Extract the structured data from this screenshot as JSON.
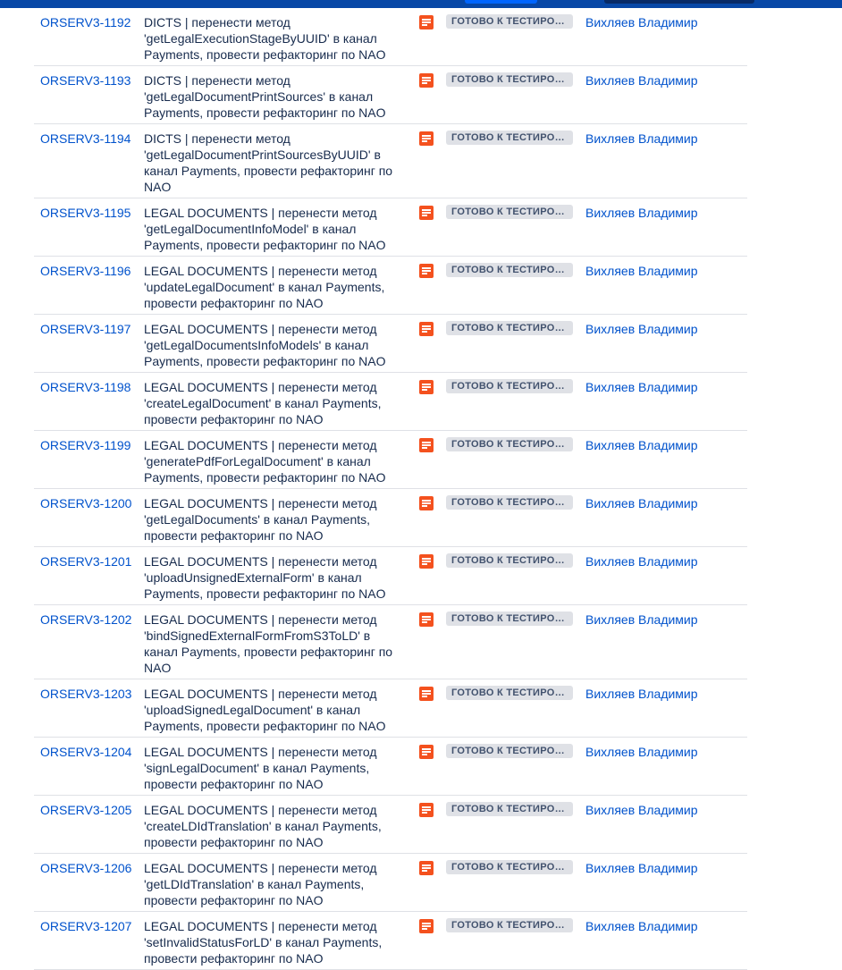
{
  "issues": [
    {
      "key": "ORSERV3-1192",
      "summary": "DICTS | перенести метод 'getLegalExecutionStageByUUID' в канал Payments, провести рефакторинг по NAO",
      "status": "ГОТОВО К ТЕСТИРОВАНИЮ",
      "assignee": "Вихляев Владимир",
      "type_icon": "task-icon"
    },
    {
      "key": "ORSERV3-1193",
      "summary": "DICTS | перенести метод 'getLegalDocumentPrintSources' в канал Payments, провести рефакторинг по NAO",
      "status": "ГОТОВО К ТЕСТИРОВАНИЮ",
      "assignee": "Вихляев Владимир",
      "type_icon": "task-icon"
    },
    {
      "key": "ORSERV3-1194",
      "summary": "DICTS | перенести метод 'getLegalDocumentPrintSourcesByUUID' в канал Payments, провести рефакторинг по NAO",
      "status": "ГОТОВО К ТЕСТИРОВАНИЮ",
      "assignee": "Вихляев Владимир",
      "type_icon": "task-icon"
    },
    {
      "key": "ORSERV3-1195",
      "summary": "LEGAL DOCUMENTS | перенести метод 'getLegalDocumentInfoModel' в канал Payments, провести рефакторинг по NAO",
      "status": "ГОТОВО К ТЕСТИРОВАНИЮ",
      "assignee": "Вихляев Владимир",
      "type_icon": "task-icon"
    },
    {
      "key": "ORSERV3-1196",
      "summary": "LEGAL DOCUMENTS | перенести метод 'updateLegalDocument' в канал Payments, провести рефакторинг по NAO",
      "status": "ГОТОВО К ТЕСТИРОВАНИЮ",
      "assignee": "Вихляев Владимир",
      "type_icon": "task-icon"
    },
    {
      "key": "ORSERV3-1197",
      "summary": "LEGAL DOCUMENTS | перенести метод 'getLegalDocumentsInfoModels' в канал Payments, провести рефакторинг по NAO",
      "status": "ГОТОВО К ТЕСТИРОВАНИЮ",
      "assignee": "Вихляев Владимир",
      "type_icon": "task-icon"
    },
    {
      "key": "ORSERV3-1198",
      "summary": "LEGAL DOCUMENTS | перенести метод 'createLegalDocument' в канал Payments, провести рефакторинг по NAO",
      "status": "ГОТОВО К ТЕСТИРОВАНИЮ",
      "assignee": "Вихляев Владимир",
      "type_icon": "task-icon"
    },
    {
      "key": "ORSERV3-1199",
      "summary": "LEGAL DOCUMENTS | перенести метод 'generatePdfForLegalDocument' в канал Payments, провести рефакторинг по NAO",
      "status": "ГОТОВО К ТЕСТИРОВАНИЮ",
      "assignee": "Вихляев Владимир",
      "type_icon": "task-icon"
    },
    {
      "key": "ORSERV3-1200",
      "summary": "LEGAL DOCUMENTS | перенести метод 'getLegalDocuments' в канал Payments, провести рефакторинг по NAO",
      "status": "ГОТОВО К ТЕСТИРОВАНИЮ",
      "assignee": "Вихляев Владимир",
      "type_icon": "task-icon"
    },
    {
      "key": "ORSERV3-1201",
      "summary": "LEGAL DOCUMENTS | перенести метод 'uploadUnsignedExternalForm' в канал Payments, провести рефакторинг по NAO",
      "status": "ГОТОВО К ТЕСТИРОВАНИЮ",
      "assignee": "Вихляев Владимир",
      "type_icon": "task-icon"
    },
    {
      "key": "ORSERV3-1202",
      "summary": "LEGAL DOCUMENTS | перенести метод 'bindSignedExternalFormFromS3ToLD' в канал Payments, провести рефакторинг по NAO",
      "status": "ГОТОВО К ТЕСТИРОВАНИЮ",
      "assignee": "Вихляев Владимир",
      "type_icon": "task-icon"
    },
    {
      "key": "ORSERV3-1203",
      "summary": "LEGAL DOCUMENTS | перенести метод 'uploadSignedLegalDocument' в канал Payments, провести рефакторинг по NAO",
      "status": "ГОТОВО К ТЕСТИРОВАНИЮ",
      "assignee": "Вихляев Владимир",
      "type_icon": "task-icon"
    },
    {
      "key": "ORSERV3-1204",
      "summary": "LEGAL DOCUMENTS | перенести метод 'signLegalDocument' в канал Payments, провести рефакторинг по NAO",
      "status": "ГОТОВО К ТЕСТИРОВАНИЮ",
      "assignee": "Вихляев Владимир",
      "type_icon": "task-icon"
    },
    {
      "key": "ORSERV3-1205",
      "summary": "LEGAL DOCUMENTS | перенести метод 'createLDIdTranslation' в канал Payments, провести рефакторинг по NAO",
      "status": "ГОТОВО К ТЕСТИРОВАНИЮ",
      "assignee": "Вихляев Владимир",
      "type_icon": "task-icon"
    },
    {
      "key": "ORSERV3-1206",
      "summary": "LEGAL DOCUMENTS | перенести метод 'getLDIdTranslation' в канал Payments, провести рефакторинг по NAO",
      "status": "ГОТОВО К ТЕСТИРОВАНИЮ",
      "assignee": "Вихляев Владимир",
      "type_icon": "task-icon"
    },
    {
      "key": "ORSERV3-1207",
      "summary": "LEGAL DOCUMENTS | перенести метод 'setInvalidStatusForLD' в канал Payments, провести рефакторинг по NAO",
      "status": "ГОТОВО К ТЕСТИРОВАНИЮ",
      "assignee": "Вихляев Владимир",
      "type_icon": "task-icon"
    }
  ]
}
